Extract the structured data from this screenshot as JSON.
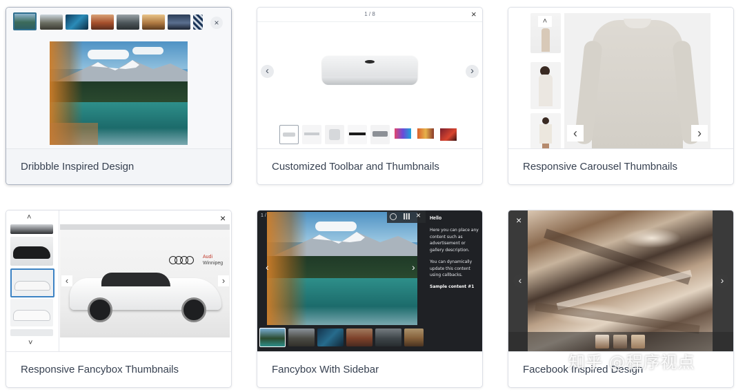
{
  "cards": [
    {
      "caption": "Dribbble Inspired Design",
      "close": "×"
    },
    {
      "caption": "Customized Toolbar and Thumbnails",
      "counter": "1 / 8",
      "close": "×",
      "prev": "‹",
      "next": "›"
    },
    {
      "caption": "Responsive Carousel Thumbnails",
      "up": "˄",
      "prev": "‹",
      "next": "›"
    },
    {
      "caption": "Responsive Fancybox Thumbnails",
      "close": "×",
      "up": "˄",
      "down": "˅",
      "prev": "‹",
      "next": "›",
      "brand_line1": "Audi",
      "brand_line2": "Winnipeg"
    },
    {
      "caption": "Fancybox With Sidebar",
      "counter": "1 / 11",
      "prev": "‹",
      "next": "›",
      "close": "×",
      "sidebar": {
        "heading": "Hello",
        "para1": [
          "Here you can place any",
          "content such as",
          "advertisement or",
          "gallery description."
        ],
        "para2": [
          "You can dynamically",
          "update this content",
          "using callbacks."
        ],
        "sample": "Sample content #1"
      }
    },
    {
      "caption": "Facebook Inspired Design",
      "close": "×",
      "prev": "‹",
      "next": "›"
    }
  ],
  "watermark": "知乎 @程序视点",
  "colors": {
    "dark_bg": "#1f2125",
    "border": "#dcdfe6",
    "caption_text": "#374151"
  }
}
